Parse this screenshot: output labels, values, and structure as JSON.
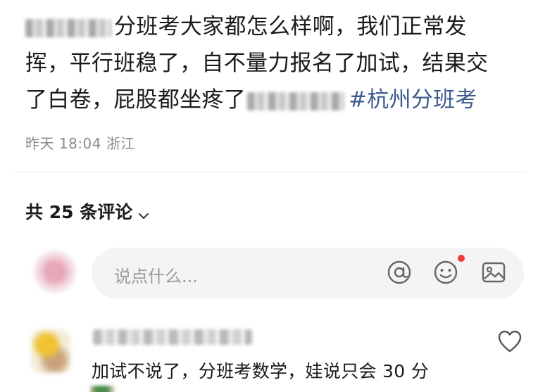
{
  "post": {
    "text_line1_rest": "分班考大家都怎么样啊，我们正常发",
    "text_line2": "挥，平行班稳了，自不量力报名了加试，结果交",
    "text_line3_start": "了白卷，屁股都坐疼了",
    "hashtag": "#杭州分班考",
    "time": "昨天 18:04",
    "location": "浙江"
  },
  "comments_header": {
    "label": "共 25 条评论"
  },
  "comment_input": {
    "placeholder": "说点什么..."
  },
  "comments": [
    {
      "text": "加试不说了，分班考数学，娃说只会 30 分"
    }
  ],
  "colors": {
    "hashtag": "#3d5b8f",
    "meta_gray": "#8a8a8a",
    "input_bg": "#f4f4f4",
    "notification_dot": "#ef3b3b"
  },
  "icons": [
    "at-icon",
    "emoji-icon",
    "image-icon",
    "heart-icon",
    "chevron-down-icon"
  ]
}
